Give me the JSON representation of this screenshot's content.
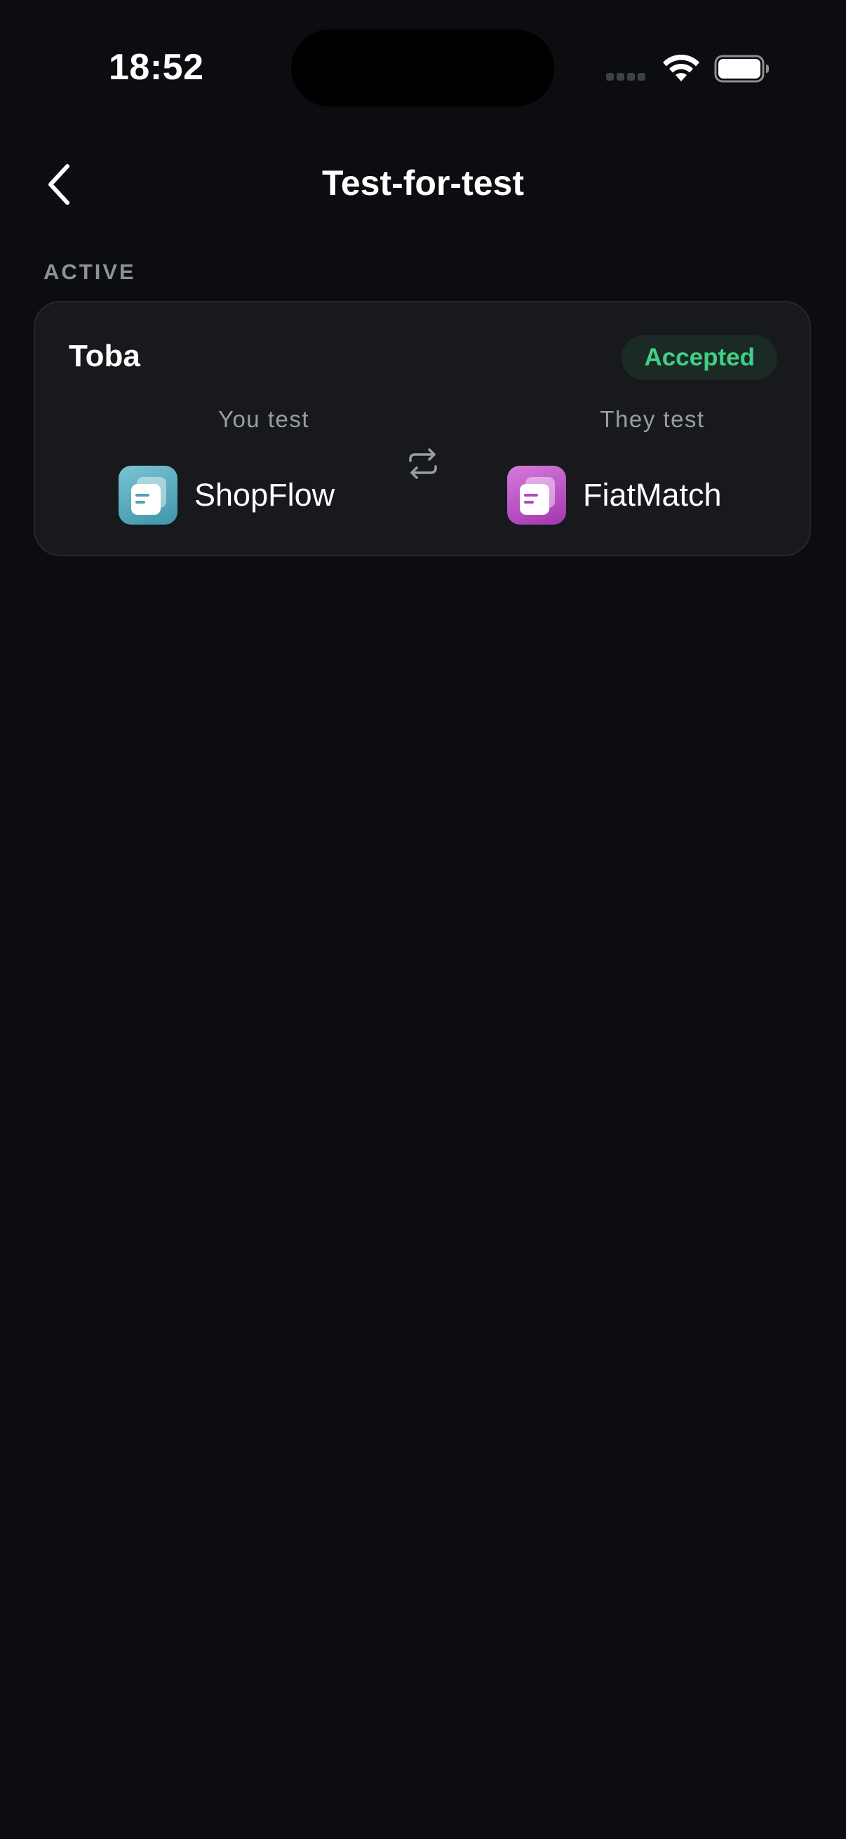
{
  "status_bar": {
    "time": "18:52"
  },
  "header": {
    "title": "Test-for-test",
    "back_icon": "chevron-left-icon"
  },
  "section": {
    "label": "ACTIVE"
  },
  "card": {
    "partner": "Toba",
    "status": "Accepted",
    "you_test_label": "You test",
    "they_test_label": "They test",
    "swap_icon": "swap-arrows-icon",
    "you_app": {
      "name": "ShopFlow",
      "icon_color": "#4aa3b6"
    },
    "they_app": {
      "name": "FiatMatch",
      "icon_color": "#b548c0"
    }
  },
  "colors": {
    "background": "#0c0d10",
    "card": "#17191d",
    "accent_green": "#3fcf86",
    "muted_text": "#9a9da4"
  }
}
